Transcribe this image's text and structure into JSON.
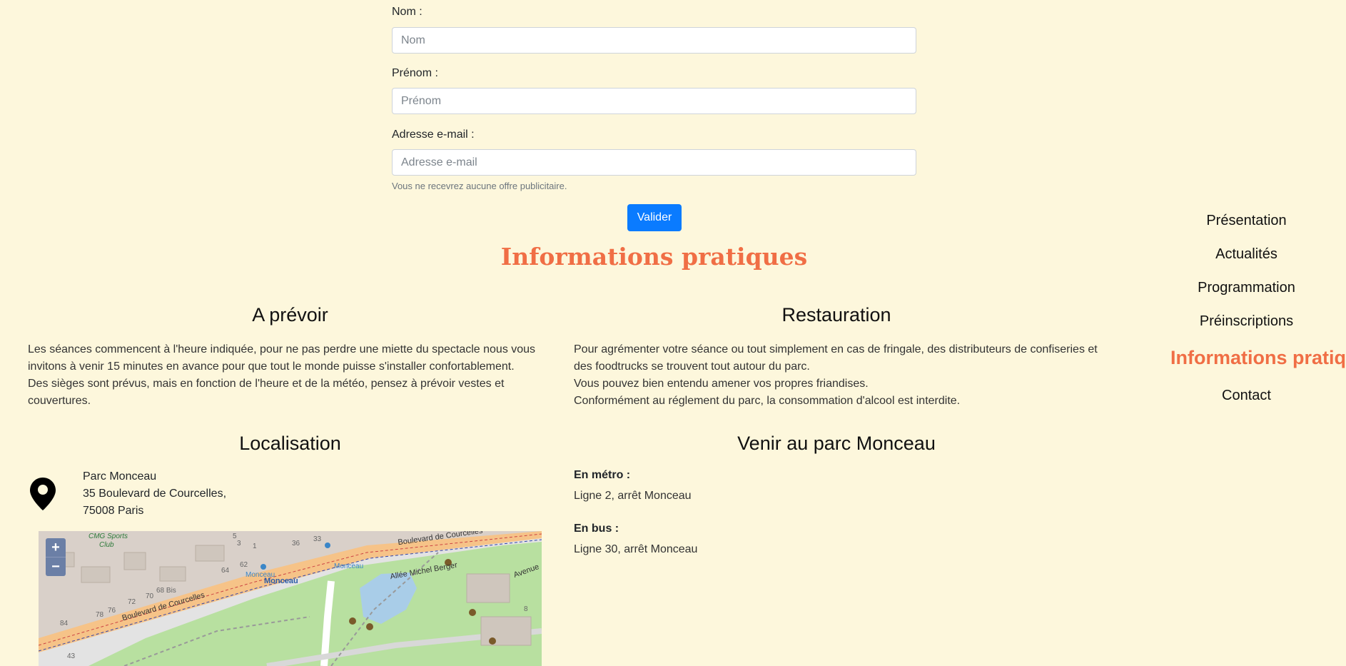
{
  "form": {
    "nom_label": "Nom :",
    "nom_placeholder": "Nom",
    "prenom_label": "Prénom :",
    "prenom_placeholder": "Prénom",
    "email_label": "Adresse e-mail :",
    "email_placeholder": "Adresse e-mail",
    "email_help": "Vous ne recevrez aucune offre publicitaire.",
    "submit_label": "Valider"
  },
  "info": {
    "title": "Informations pratiques",
    "prevoir": {
      "title": "A prévoir",
      "line1": "Les séances commencent à l'heure indiquée, pour ne pas perdre une miette du spectacle nous vous invitons à venir 15 minutes en avance pour que tout le monde puisse s'installer confortablement.",
      "line2": "Des sièges sont prévus, mais en fonction de l'heure et de la météo, pensez à prévoir vestes et couvertures."
    },
    "restauration": {
      "title": "Restauration",
      "line1": "Pour agrémenter votre séance ou tout simplement en cas de fringale, des distributeurs de confiseries et des foodtrucks se trouvent tout autour du parc.",
      "line2": "Vous pouvez bien entendu amener vos propres friandises.",
      "line3": "Conformément au réglement du parc, la consommation d'alcool est interdite."
    },
    "localisation": {
      "title": "Localisation",
      "address_line1": "Parc Monceau",
      "address_line2": "35 Boulevard de Courcelles,",
      "address_line3": "75008 Paris"
    },
    "venir": {
      "title": "Venir au parc Monceau",
      "metro_label": "En métro :",
      "metro_value": "Ligne 2, arrêt Monceau",
      "bus_label": "En bus :",
      "bus_value": "Ligne 30, arrêt Monceau"
    }
  },
  "map": {
    "zoom_in": "+",
    "zoom_out": "−",
    "labels": {
      "club": "CMG Sports",
      "club2": "Club",
      "boulevard_top": "Boulevard de Courcelles",
      "boulevard_left": "Boulevard de Courcelles",
      "allee": "Allée Michel Berger",
      "monceau1": "Monceau",
      "monceau2": "Monceau",
      "monceau3": "Monceau",
      "avenue": "Avenue",
      "bis68": "68 Bis",
      "n64": "64",
      "n62": "62",
      "n70": "70",
      "n72": "72",
      "n76": "76",
      "n78": "78",
      "n84": "84",
      "n43": "43",
      "n33": "33",
      "n36": "36",
      "n5": "5",
      "n3": "3",
      "n1": "1",
      "n8": "8"
    }
  },
  "nav": {
    "items": [
      "Présentation",
      "Actualités",
      "Programmation",
      "Préinscriptions",
      "Informations pratiques",
      "Contact"
    ],
    "active_index": 4
  },
  "colors": {
    "background": "#fdf7dc",
    "accent": "#f06e45",
    "button": "#0a7bff"
  }
}
